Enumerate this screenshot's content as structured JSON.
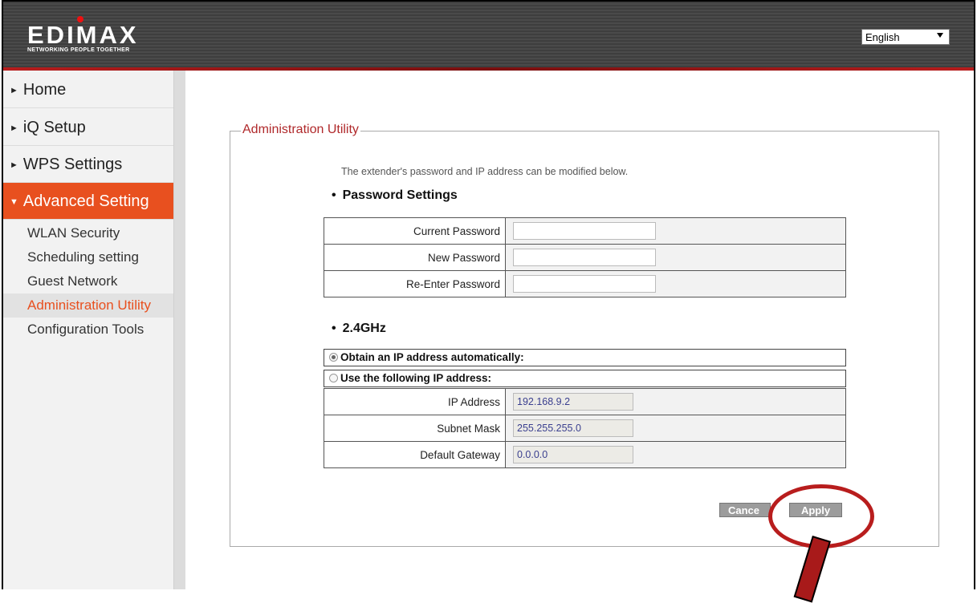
{
  "header": {
    "logo_text": "EDIMAX",
    "logo_tagline": "NETWORKING PEOPLE TOGETHER",
    "language": "English"
  },
  "sidebar": {
    "main_items": [
      {
        "label": "Home",
        "arrow": "►"
      },
      {
        "label": "iQ Setup",
        "arrow": "►"
      },
      {
        "label": "WPS Settings",
        "arrow": "►"
      },
      {
        "label": "Advanced Setting",
        "arrow": "▼",
        "active": true
      }
    ],
    "sub_items": [
      {
        "label": "WLAN Security"
      },
      {
        "label": "Scheduling setting"
      },
      {
        "label": "Guest Network"
      },
      {
        "label": "Administration Utility",
        "active": true
      },
      {
        "label": "Configuration Tools"
      }
    ]
  },
  "main": {
    "legend": "Administration Utility",
    "description": "The extender's password and IP address can be modified below.",
    "password_section": {
      "bullet": "•",
      "title": "Password Settings",
      "fields": [
        {
          "label": "Current Password",
          "value": ""
        },
        {
          "label": "New Password",
          "value": ""
        },
        {
          "label": "Re-Enter Password",
          "value": ""
        }
      ]
    },
    "ip_section": {
      "bullet": "•",
      "title": "2.4GHz",
      "option_auto": "Obtain an IP address automatically:",
      "option_manual": "Use the following IP address:",
      "selected": "auto",
      "fields": [
        {
          "label": "IP Address",
          "value": "192.168.9.2"
        },
        {
          "label": "Subnet Mask",
          "value": "255.255.255.0"
        },
        {
          "label": "Default Gateway",
          "value": "0.0.0.0"
        }
      ]
    },
    "buttons": {
      "cancel": "Cance",
      "apply": "Apply"
    }
  },
  "annotation": {
    "highlight_color": "#b81d1d"
  }
}
